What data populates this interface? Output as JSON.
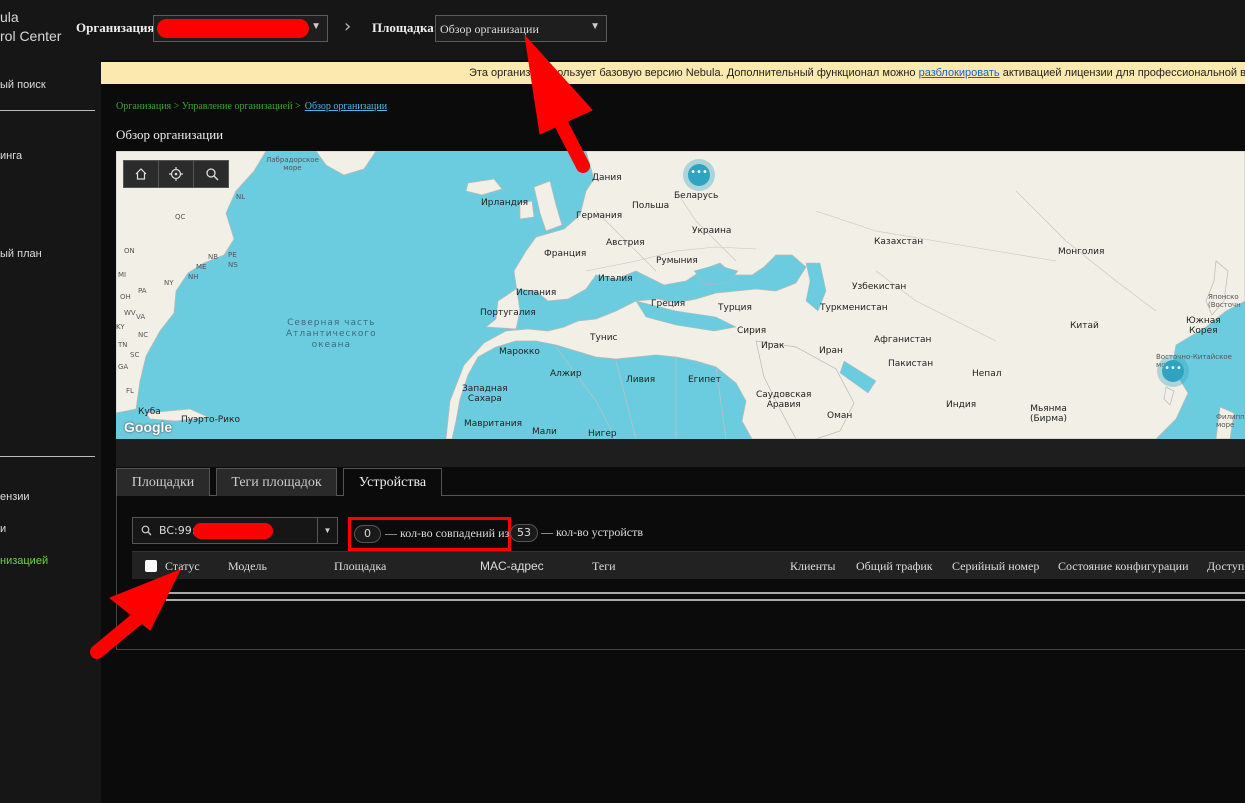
{
  "brand": {
    "line1": "ula",
    "line2": "rol Center"
  },
  "header": {
    "org_label": "Организация:",
    "site_label": "Площадка:",
    "site_value": "Обзор организации",
    "redaction_color": "#ff0000"
  },
  "sidebar": {
    "items": [
      "ый поиск",
      "инга",
      "ый план",
      "ензии",
      "и",
      "низацией"
    ],
    "active_index": 5,
    "active_color": "#6fd14a"
  },
  "banner": {
    "text_before": "Эта организа",
    "text_mid": "использует базовую версию Nebula. Дополнительный функционал можно",
    "link": "разблокировать",
    "text_after": "активацией лицензии для профессиональной в"
  },
  "breadcrumb": {
    "path": "Организация > Управление организацией >",
    "current": "Обзор организации"
  },
  "page_title": "Обзор организации",
  "map": {
    "tools": [
      "home-icon",
      "locate-icon",
      "search-icon"
    ],
    "labels": {
      "labrador": "Лабрадорское\nморе",
      "ocean": "Северная часть\nАтлантического\nокеана",
      "qc": "QC",
      "nl": "NL",
      "on": "ON",
      "pe": "PE",
      "ns": "NS",
      "nb": "NB",
      "me": "ME",
      "nh": "NH",
      "ny": "NY",
      "mi": "MI",
      "oh": "OH",
      "pa": "PA",
      "va": "VA",
      "nc": "NC",
      "sc": "SC",
      "ga": "GA",
      "fl": "FL",
      "ky": "KY",
      "tn": "TN",
      "wv": "WV",
      "cuba": "Куба",
      "pr": "Пуэрто-Рико",
      "denmark": "Дания",
      "ireland": "Ирландия",
      "belarus": "Беларусь",
      "germany": "Германия",
      "poland": "Польша",
      "ukraine": "Украина",
      "france": "Франция",
      "austria": "Австрия",
      "romania": "Румыния",
      "italy": "Италия",
      "spain": "Испания",
      "portugal": "Португалия",
      "greece": "Греция",
      "turkey": "Турция",
      "syria": "Сирия",
      "iraq": "Ирак",
      "iran": "Иран",
      "tunisia": "Тунис",
      "morocco": "Марокко",
      "algeria": "Алжир",
      "libya": "Ливия",
      "egypt": "Египет",
      "saudi": "Саудовская\nАравия",
      "oman": "Оман",
      "wsahara": "Западная\nСахара",
      "mauritania": "Мавритания",
      "mali": "Мали",
      "niger": "Нигер",
      "kazakhstan": "Казахстан",
      "uzbekistan": "Узбекистан",
      "turkmenistan": "Туркменистан",
      "afghanistan": "Афганистан",
      "pakistan": "Пакистан",
      "india": "Индия",
      "nepal": "Непал",
      "mongolia": "Монголия",
      "china": "Китай",
      "skorea": "Южная\nКорея",
      "myanmar": "Мьянма\n(Бирма)",
      "ecsea": "Восточно-Китайское\nморе",
      "japansea": "Японско\n(Восточн",
      "philippine": "Филиппин\nморе"
    },
    "clusters": [
      "•••",
      "•••"
    ],
    "google": "Google",
    "land_color": "#f1efe6",
    "water_color": "#6cccdf"
  },
  "tabs": [
    {
      "label": "Площадки",
      "active": false
    },
    {
      "label": "Теги площадок",
      "active": false
    },
    {
      "label": "Устройства",
      "active": true
    }
  ],
  "filter": {
    "search_value": "BC:99:",
    "matches": "0",
    "matches_text": "— кол-во совпадений из",
    "total": "53",
    "total_text": "— кол-во устройств"
  },
  "table": {
    "columns": [
      "Статус",
      "Модель",
      "Площадка",
      "MAC-адрес",
      "Теги",
      "Клиенты",
      "Общий трафик",
      "Серийный номер",
      "Состояние конфигурации",
      "Доступ"
    ]
  }
}
